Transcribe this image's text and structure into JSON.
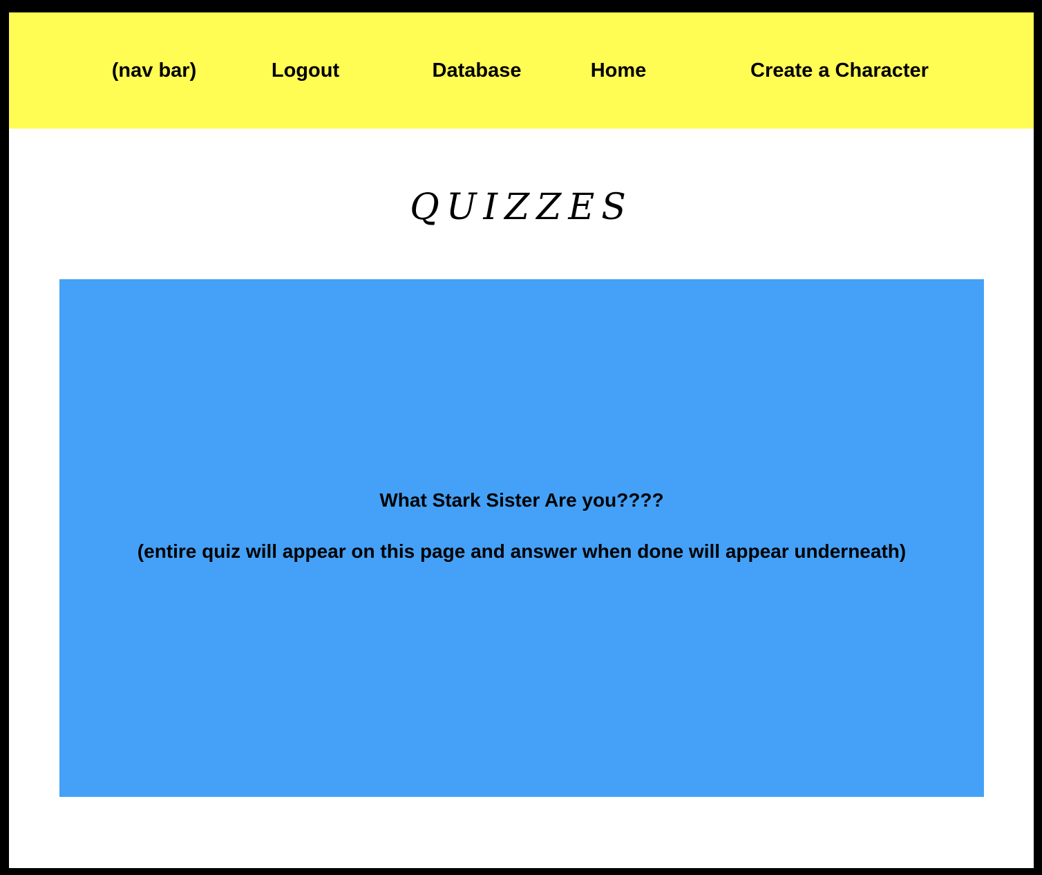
{
  "nav": {
    "label": "(nav bar)",
    "items": [
      {
        "label": "Logout"
      },
      {
        "label": "Database"
      },
      {
        "label": "Home"
      },
      {
        "label": "Create a Character"
      }
    ],
    "background": "#fffc54"
  },
  "page": {
    "title": "Quizzes"
  },
  "quiz": {
    "title": "What Stark Sister Are you????",
    "note": "(entire quiz will appear on this page and answer when done will appear underneath)",
    "background": "#44a1f7"
  }
}
